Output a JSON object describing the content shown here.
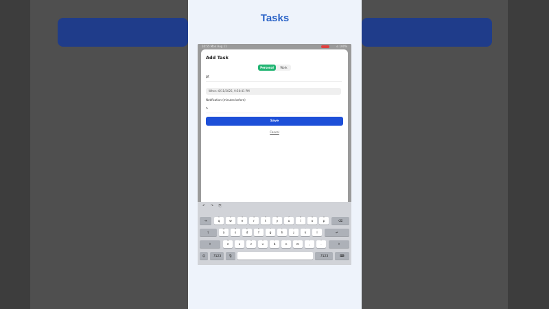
{
  "page": {
    "title": "Tasks"
  },
  "status_bar": {
    "time": "10:55  Mon Aug 11",
    "right": "⊙ 100%"
  },
  "sheet": {
    "title": "Add Task",
    "tabs": [
      {
        "label": "Personal",
        "selected": true
      },
      {
        "label": "Work",
        "selected": false
      }
    ],
    "task_input_value": "pt",
    "when_text": "When: 8/11/2025, 9:56:41 PM",
    "notification_label": "Notification (minutes before)",
    "notification_value": "5",
    "save_label": "Save",
    "cancel_label": "Cancel"
  },
  "keyboard": {
    "toolbar": [
      "↶",
      "↷",
      "⎘"
    ],
    "row1": [
      {
        "key": "q",
        "sub": "1"
      },
      {
        "key": "w",
        "sub": "2"
      },
      {
        "key": "e",
        "sub": "3"
      },
      {
        "key": "r",
        "sub": "4"
      },
      {
        "key": "t",
        "sub": "5"
      },
      {
        "key": "y",
        "sub": "6"
      },
      {
        "key": "u",
        "sub": "7"
      },
      {
        "key": "i",
        "sub": "8"
      },
      {
        "key": "o",
        "sub": "9"
      },
      {
        "key": "p",
        "sub": "0"
      }
    ],
    "row2": [
      {
        "key": "a",
        "sub": "@"
      },
      {
        "key": "s",
        "sub": "#"
      },
      {
        "key": "d",
        "sub": "$"
      },
      {
        "key": "f",
        "sub": "&"
      },
      {
        "key": "g",
        "sub": "*"
      },
      {
        "key": "h",
        "sub": "("
      },
      {
        "key": "j",
        "sub": ")"
      },
      {
        "key": "k",
        "sub": "'"
      },
      {
        "key": "l",
        "sub": "\""
      }
    ],
    "row3": [
      {
        "key": "z",
        "sub": "%"
      },
      {
        "key": "x",
        "sub": "-"
      },
      {
        "key": "c",
        "sub": "+"
      },
      {
        "key": "v",
        "sub": "="
      },
      {
        "key": "b",
        "sub": "/"
      },
      {
        "key": "n",
        "sub": ";"
      },
      {
        "key": "m",
        "sub": ":"
      },
      {
        "key": ",",
        "sub": "!"
      },
      {
        "key": ".",
        "sub": "?"
      }
    ],
    "tab_label": "⇥",
    "delete_label": "⌫",
    "caps_label": "⇪",
    "return_label": "↵",
    "shift_label": "⇧",
    "emoji_label": "☺",
    "numbers_label": ".?123",
    "mic_label": "🎙",
    "hide_label": "⌨"
  },
  "colors": {
    "title": "#2a63c7",
    "segment_selected": "#22b573",
    "save_button": "#1d4fd8"
  }
}
